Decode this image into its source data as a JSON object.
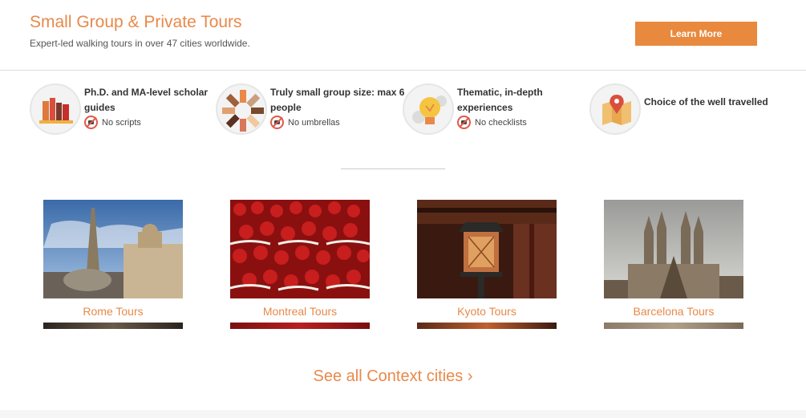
{
  "header": {
    "title": "Small Group & Private Tours",
    "subtitle": "Expert-led walking tours in over 47 cities worldwide.",
    "cta_label": "Learn More"
  },
  "features": [
    {
      "title": "Ph.D. and MA-level scholar guides",
      "note": "No scripts",
      "icon": "books-icon",
      "no_icon": "no-scripts-icon"
    },
    {
      "title": "Truly small group size: max 6 people",
      "note": "No umbrellas",
      "icon": "hands-icon",
      "no_icon": "no-umbrellas-icon"
    },
    {
      "title": "Thematic, in-depth experiences",
      "note": "No checklists",
      "icon": "lightbulb-icon",
      "no_icon": "no-checklists-icon"
    },
    {
      "title": "Choice of the well travelled",
      "note": "",
      "icon": "map-pin-icon"
    }
  ],
  "cities": [
    {
      "label": "Rome Tours"
    },
    {
      "label": "Montreal Tours"
    },
    {
      "label": "Kyoto Tours"
    },
    {
      "label": "Barcelona Tours"
    }
  ],
  "see_all": "See all Context cities ›",
  "colors": {
    "accent": "#e8894a",
    "button": "#e8893e",
    "divider": "#dddddd"
  }
}
